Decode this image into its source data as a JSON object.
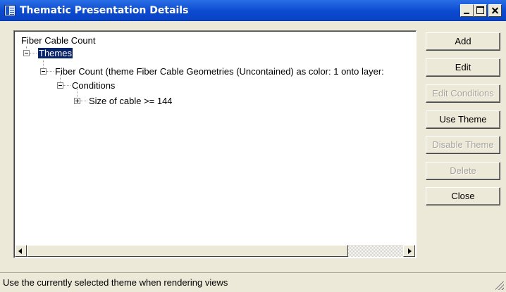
{
  "window": {
    "title": "Thematic Presentation Details",
    "icon": "table-icon"
  },
  "tree": {
    "root": "Fiber Cable Count",
    "themes": "Themes",
    "fiber_count": "Fiber Count (theme Fiber Cable Geometries (Uncontained) as color: 1 onto layer:",
    "conditions": "Conditions",
    "size_condition": "Size of cable >= 144"
  },
  "buttons": {
    "add": "Add",
    "edit": "Edit",
    "edit_conditions": "Edit Conditions",
    "use_theme": "Use Theme",
    "disable_theme": "Disable Theme",
    "delete": "Delete",
    "close": "Close"
  },
  "status": {
    "text": "Use the currently selected theme when rendering views"
  }
}
